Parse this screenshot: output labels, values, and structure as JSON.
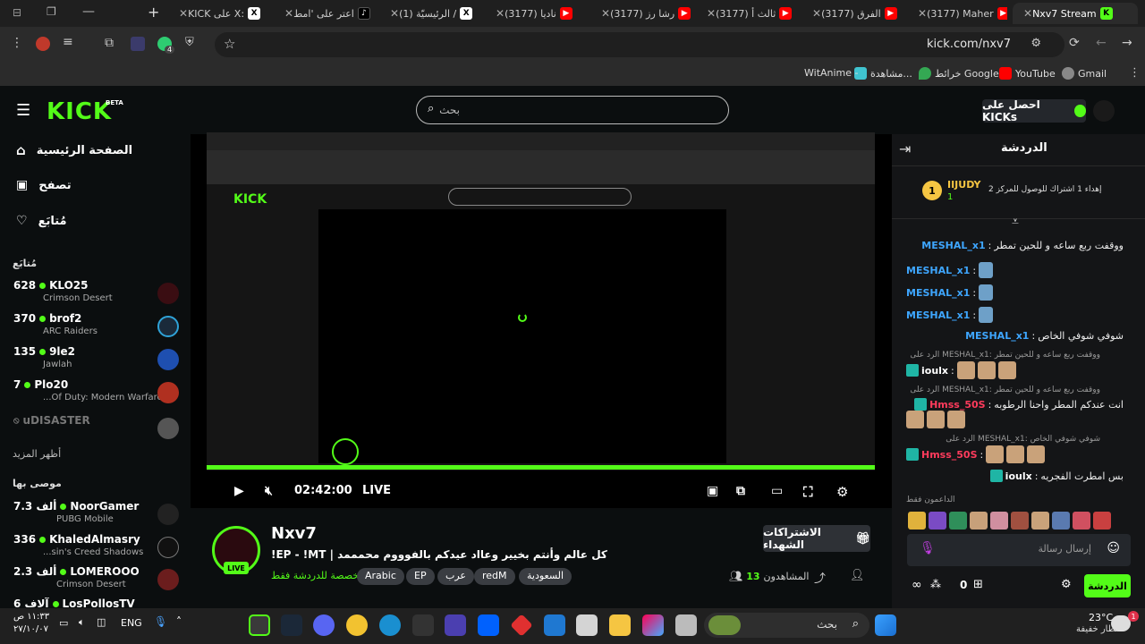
{
  "browser": {
    "tabs": [
      {
        "label": "KICK على X: ",
        "icon": "x"
      },
      {
        "label": "اعتر على 'امط",
        "icon": "tiktok"
      },
      {
        "label": "(1) الرئيسيّة /",
        "icon": "x"
      },
      {
        "label": "(3177) ناديا",
        "icon": "youtube"
      },
      {
        "label": "(3177) رشا رز",
        "icon": "youtube"
      },
      {
        "label": "(3177) ثالث أ",
        "icon": "youtube"
      },
      {
        "label": "(3177) الفرق",
        "icon": "youtube"
      },
      {
        "label": "(3177) Maher",
        "icon": "youtube"
      },
      {
        "label": "Nxv7 Stream",
        "icon": "kick"
      }
    ],
    "url": "kick.com/nxv7",
    "bookmarks": [
      {
        "label": "Gmail",
        "icon": "gmail"
      },
      {
        "label": "YouTube",
        "icon": "youtube"
      },
      {
        "label": "خرائط Google",
        "icon": "maps"
      },
      {
        "label": "مشاهدة...",
        "icon": "bookmark"
      },
      {
        "label": "WitAnime -",
        "icon": "bookmark"
      }
    ],
    "extension_badge": "4"
  },
  "kick": {
    "logo": "KICK",
    "beta": "BETA",
    "search_placeholder": "بحث",
    "get_kicks": "احصل على KICKs"
  },
  "sidebar": {
    "nav": [
      {
        "label": "الصفحة الرئيسية",
        "icon": "home-icon"
      },
      {
        "label": "تصفح",
        "icon": "browse-icon"
      },
      {
        "label": "مُتابَع",
        "icon": "heart-icon"
      }
    ],
    "following_header": "مُتابَع",
    "following": [
      {
        "count": "628",
        "name": "KLO25",
        "game": "Crimson Desert"
      },
      {
        "count": "370",
        "name": "brof2",
        "game": "ARC Raiders"
      },
      {
        "count": "135",
        "name": "9le2",
        "game": "Jawlah"
      },
      {
        "count": "7",
        "name": "Plo20",
        "game": "...Of Duty: Modern Warfare"
      }
    ],
    "offline": "uDISASTER",
    "show_more": "أظهر المزيد",
    "recommended_header": "موصى بها",
    "recommended": [
      {
        "count": "7.3 ألف",
        "name": "NoorGamer",
        "game": "PUBG Mobile"
      },
      {
        "count": "336",
        "name": "KhaledAlmasry",
        "game": "...sin's Creed Shadows"
      },
      {
        "count": "2.3 ألف",
        "name": "LOMEROOO",
        "game": "Crimson Desert"
      },
      {
        "count": "6 آلاف",
        "name": "LosPollosTV",
        "game": ""
      }
    ]
  },
  "player": {
    "time": "02:42:00",
    "live": "LIVE"
  },
  "stream": {
    "streamer": "Nxv7",
    "title": "!EP - !MT | كل عالم وأنتم بخيير وعااد عيدكم بالفوووم محمممد",
    "chat_only": "مخصصة للدردشة فقط",
    "tags": [
      "Arabic",
      "EP",
      "عرب",
      "redM",
      "السعودية"
    ],
    "subs_button": "الاشتراكات الشهداء",
    "viewers_label": "المشاهدون",
    "viewers": "13",
    "live": "LIVE"
  },
  "chat": {
    "title": "الدردشة",
    "gifter_name": "IIJUDY",
    "gifter_rank": "1",
    "gifter_count": "1",
    "gift_text": "إهداء 1 اشتراك للوصول للمركز 2",
    "messages": [
      {
        "user": "MESHAL_x1",
        "text": "ووقفت ربع ساعه و للحين تمطر"
      },
      {
        "user": "MESHAL_x1",
        "text": ""
      },
      {
        "user": "MESHAL_x1",
        "text": ""
      },
      {
        "user": "MESHAL_x1",
        "text": ""
      },
      {
        "user": "MESHAL_x1",
        "text": "شوفي شوفي الخاص"
      }
    ],
    "reply1": "الرد على MESHAL_x1: ووقفت ربع ساعه و للحين تمطر",
    "msg6_user": "ioulx",
    "reply2": "الرد على MESHAL_x1: ووقفت ربع ساعه و للحين تمطر",
    "msg7_user": "Hmss_50S",
    "msg7_text": "انت عندكم المطر واحنا الرطوبه",
    "reply3": "الرد على MESHAL_x1: شوفي شوفي الخاص",
    "msg8_user": "Hmss_50S",
    "msg9_user": "ioulx",
    "msg9_text": "بس امطرت الفجريه",
    "supporters": "الداعمون فقط",
    "input_placeholder": "إرسال رسالة",
    "kicks_count": "0",
    "send_button": "الدردشة"
  },
  "taskbar": {
    "weather": "23°C",
    "weather_desc": "أمطار خفيفة",
    "search": "بحث",
    "lang": "ENG",
    "time": "١١:٣٣ ص",
    "date": "٢٧/١٠/٠٧",
    "weather_badge": "1"
  },
  "colors": {
    "accent": "#53fc18",
    "chat_blue": "#3ea6ff",
    "chat_red": "#ff3b5c"
  }
}
